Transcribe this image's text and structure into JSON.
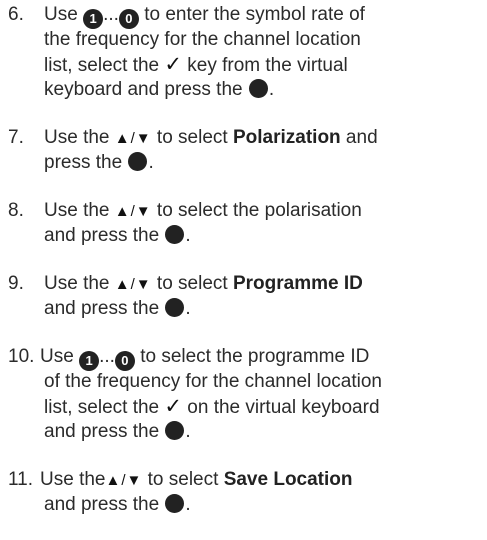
{
  "steps": [
    {
      "number": "6.",
      "lines": [
        {
          "parts": [
            {
              "t": "text",
              "v": "Use "
            },
            {
              "t": "key",
              "v": "1"
            },
            {
              "t": "text",
              "v": "..."
            },
            {
              "t": "key",
              "v": "0"
            },
            {
              "t": "text",
              "v": " to enter the symbol rate of"
            }
          ]
        },
        {
          "parts": [
            {
              "t": "text",
              "v": "the frequency for the channel location"
            }
          ]
        },
        {
          "parts": [
            {
              "t": "text",
              "v": "list, select the "
            },
            {
              "t": "check",
              "v": "✓"
            },
            {
              "t": "text",
              "v": " key from the virtual"
            }
          ]
        },
        {
          "parts": [
            {
              "t": "text",
              "v": "keyboard and press the "
            },
            {
              "t": "circle",
              "v": ""
            },
            {
              "t": "text",
              "v": "."
            }
          ]
        }
      ]
    },
    {
      "number": "7.",
      "lines": [
        {
          "parts": [
            {
              "t": "text",
              "v": "Use the "
            },
            {
              "t": "arrows",
              "v": "▲/▼"
            },
            {
              "t": "text",
              "v": " to select "
            },
            {
              "t": "bold",
              "v": "Polarization"
            },
            {
              "t": "text",
              "v": " and"
            }
          ]
        },
        {
          "parts": [
            {
              "t": "text",
              "v": "press the "
            },
            {
              "t": "circle",
              "v": ""
            },
            {
              "t": "text",
              "v": "."
            }
          ]
        }
      ]
    },
    {
      "number": "8.",
      "lines": [
        {
          "parts": [
            {
              "t": "text",
              "v": "Use the "
            },
            {
              "t": "arrows",
              "v": "▲/▼"
            },
            {
              "t": "text",
              "v": " to select the polarisation"
            }
          ]
        },
        {
          "parts": [
            {
              "t": "text",
              "v": "and press the "
            },
            {
              "t": "circle",
              "v": ""
            },
            {
              "t": "text",
              "v": "."
            }
          ]
        }
      ]
    },
    {
      "number": "9.",
      "lines": [
        {
          "parts": [
            {
              "t": "text",
              "v": "Use the "
            },
            {
              "t": "arrows",
              "v": "▲/▼"
            },
            {
              "t": "text",
              "v": " to select "
            },
            {
              "t": "bold",
              "v": "Programme ID"
            }
          ]
        },
        {
          "parts": [
            {
              "t": "text",
              "v": "and press the "
            },
            {
              "t": "circle",
              "v": ""
            },
            {
              "t": "text",
              "v": "."
            }
          ]
        }
      ]
    },
    {
      "number": "10.",
      "lines": [
        {
          "parts": [
            {
              "t": "text",
              "v": "Use "
            },
            {
              "t": "key",
              "v": "1"
            },
            {
              "t": "text",
              "v": "..."
            },
            {
              "t": "key",
              "v": "0"
            },
            {
              "t": "text",
              "v": " to select the programme ID"
            }
          ]
        },
        {
          "parts": [
            {
              "t": "text",
              "v": "of the frequency for the channel location"
            }
          ]
        },
        {
          "parts": [
            {
              "t": "text",
              "v": "list, select the "
            },
            {
              "t": "check",
              "v": "✓"
            },
            {
              "t": "text",
              "v": " on the virtual keyboard"
            }
          ]
        },
        {
          "parts": [
            {
              "t": "text",
              "v": "and press the "
            },
            {
              "t": "circle",
              "v": ""
            },
            {
              "t": "text",
              "v": "."
            }
          ]
        }
      ]
    },
    {
      "number": "11.",
      "lines": [
        {
          "parts": [
            {
              "t": "text",
              "v": "Use the"
            },
            {
              "t": "arrows",
              "v": "▲/▼"
            },
            {
              "t": "text",
              "v": " to select "
            },
            {
              "t": "bold",
              "v": "Save Location"
            }
          ]
        },
        {
          "parts": [
            {
              "t": "text",
              "v": "and press the "
            },
            {
              "t": "circle",
              "v": ""
            },
            {
              "t": "text",
              "v": "."
            }
          ]
        }
      ]
    }
  ],
  "icons": {
    "ok": "filled-circle-ok-icon",
    "check": "checkmark-icon",
    "arrows": "up-down-arrow-icon",
    "key": "numeric-key-icon"
  }
}
